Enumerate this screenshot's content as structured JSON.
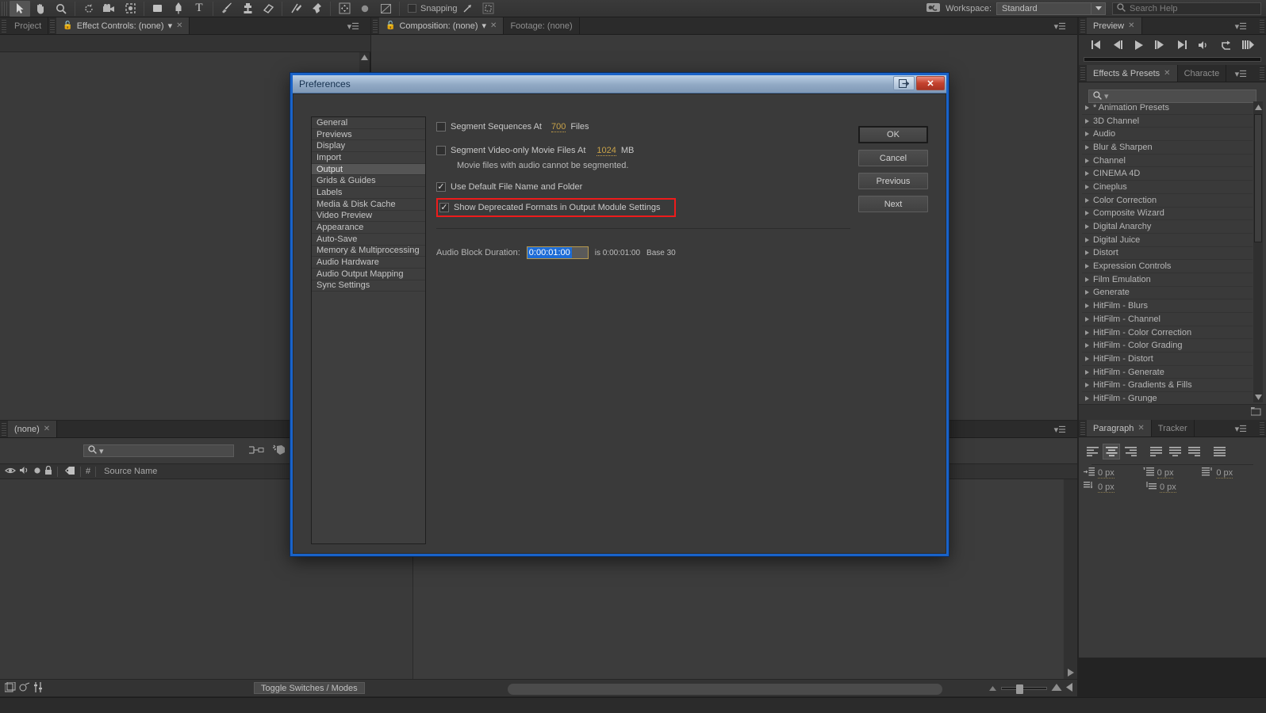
{
  "toolbar": {
    "tools": [
      {
        "name": "selection-tool",
        "glyph": "▲",
        "selected": true
      },
      {
        "name": "hand-tool",
        "glyph": "✋",
        "selected": false
      },
      {
        "name": "zoom-tool",
        "glyph": "🔍",
        "selected": false
      },
      {
        "name": "rotation-tool",
        "glyph": "↻",
        "selected": false
      },
      {
        "name": "camera-tool",
        "glyph": "🎥",
        "selected": false
      },
      {
        "name": "pan-behind-tool",
        "glyph": "✥",
        "selected": false
      },
      {
        "name": "shape-tool",
        "glyph": "▅",
        "selected": false
      },
      {
        "name": "pen-tool",
        "glyph": "✒",
        "selected": false
      },
      {
        "name": "type-tool",
        "glyph": "T",
        "selected": false
      },
      {
        "name": "brush-tool",
        "glyph": "／",
        "selected": false
      },
      {
        "name": "clone-stamp-tool",
        "glyph": "⎙",
        "selected": false
      },
      {
        "name": "eraser-tool",
        "glyph": "▱",
        "selected": false
      },
      {
        "name": "roto-brush-tool",
        "glyph": "⚡",
        "selected": false
      },
      {
        "name": "puppet-pin-tool",
        "glyph": "📌",
        "selected": false
      }
    ],
    "snapping_label": "Snapping",
    "workspace_label": "Workspace:",
    "workspace_value": "Standard",
    "search_help_placeholder": "Search Help"
  },
  "panels": {
    "project_tab": "Project",
    "effect_controls_tab": "Effect Controls: (none)",
    "composition_tab": "Composition: (none)",
    "footage_tab": "Footage: (none)",
    "preview_tab": "Preview",
    "effects_presets_tab": "Effects & Presets",
    "character_tab": "Characte",
    "paragraph_tab": "Paragraph",
    "tracker_tab": "Tracker",
    "timeline_tab": "(none)"
  },
  "preview": {
    "buttons": [
      {
        "name": "first-frame-button",
        "glyph": "|◀"
      },
      {
        "name": "previous-frame-button",
        "glyph": "◀|"
      },
      {
        "name": "play-button",
        "glyph": "▶"
      },
      {
        "name": "next-frame-button",
        "glyph": "|▶"
      },
      {
        "name": "last-frame-button",
        "glyph": "▶|"
      },
      {
        "name": "audio-toggle-button",
        "glyph": "🔊"
      },
      {
        "name": "loop-button",
        "glyph": "↻"
      },
      {
        "name": "ram-preview-button",
        "glyph": "⫸"
      }
    ]
  },
  "effects": {
    "search_placeholder": "",
    "items": [
      "* Animation Presets",
      "3D Channel",
      "Audio",
      "Blur & Sharpen",
      "Channel",
      "CINEMA 4D",
      "Cineplus",
      "Color Correction",
      "Composite Wizard",
      "Digital Anarchy",
      "Digital Juice",
      "Distort",
      "Expression Controls",
      "Film Emulation",
      "Generate",
      "HitFilm - Blurs",
      "HitFilm - Channel",
      "HitFilm - Color Correction",
      "HitFilm - Color Grading",
      "HitFilm - Distort",
      "HitFilm - Generate",
      "HitFilm - Gradients & Fills",
      "HitFilm - Grunge"
    ]
  },
  "paragraph": {
    "align_buttons": [
      {
        "name": "align-left-button",
        "selected": false
      },
      {
        "name": "align-center-button",
        "selected": true
      },
      {
        "name": "align-right-button",
        "selected": false
      },
      {
        "name": "justify-last-left-button",
        "selected": false
      },
      {
        "name": "justify-last-center-button",
        "selected": false
      },
      {
        "name": "justify-last-right-button",
        "selected": false
      },
      {
        "name": "justify-all-button",
        "selected": false
      }
    ],
    "indent_left": "0 px",
    "indent_first": "0 px",
    "indent_right": "0 px",
    "space_before": "0 px",
    "space_after": "0 px"
  },
  "timeline": {
    "column_source_name": "Source Name",
    "toggle_switches_label": "Toggle Switches / Modes",
    "hash_label": "#"
  },
  "dialog": {
    "title": "Preferences",
    "window_buttons": [
      {
        "name": "help-button",
        "glyph": "⎆"
      },
      {
        "name": "close-button",
        "glyph": "✕"
      }
    ],
    "sidebar": [
      {
        "label": "General",
        "selected": false
      },
      {
        "label": "Previews",
        "selected": false
      },
      {
        "label": "Display",
        "selected": false
      },
      {
        "label": "Import",
        "selected": false
      },
      {
        "label": "Output",
        "selected": true
      },
      {
        "label": "Grids & Guides",
        "selected": false
      },
      {
        "label": "Labels",
        "selected": false
      },
      {
        "label": "Media & Disk Cache",
        "selected": false
      },
      {
        "label": "Video Preview",
        "selected": false
      },
      {
        "label": "Appearance",
        "selected": false
      },
      {
        "label": "Auto-Save",
        "selected": false
      },
      {
        "label": "Memory & Multiprocessing",
        "selected": false
      },
      {
        "label": "Audio Hardware",
        "selected": false
      },
      {
        "label": "Audio Output Mapping",
        "selected": false
      },
      {
        "label": "Sync Settings",
        "selected": false
      }
    ],
    "options": {
      "segment_sequences_label": "Segment Sequences At",
      "segment_sequences_value": "700",
      "segment_sequences_unit": "Files",
      "segment_sequences_checked": false,
      "segment_video_label": "Segment Video-only Movie Files At",
      "segment_video_value": "1024",
      "segment_video_unit": "MB",
      "segment_video_checked": false,
      "segment_note": "Movie files with audio cannot be segmented.",
      "use_default_label": "Use Default File Name and Folder",
      "use_default_checked": true,
      "show_deprecated_label": "Show Deprecated Formats in Output Module Settings",
      "show_deprecated_checked": true,
      "show_deprecated_highlight_color": "#ee1b1b",
      "audio_block_label": "Audio Block Duration:",
      "audio_block_value": "0:00:01:00",
      "audio_block_note_is": "is 0:00:01:00",
      "audio_block_note_base": "Base 30"
    },
    "buttons": [
      {
        "label": "OK",
        "name": "ok-button",
        "primary": true
      },
      {
        "label": "Cancel",
        "name": "cancel-button",
        "primary": false
      },
      {
        "label": "Previous",
        "name": "previous-button",
        "primary": false
      },
      {
        "label": "Next",
        "name": "next-button",
        "primary": false
      }
    ]
  },
  "colors": {
    "dialog_outline": "#1963c9",
    "accent_number": "#c8a249",
    "highlight_red": "#ee1b1b",
    "selection_blue": "#1d6cd6"
  }
}
